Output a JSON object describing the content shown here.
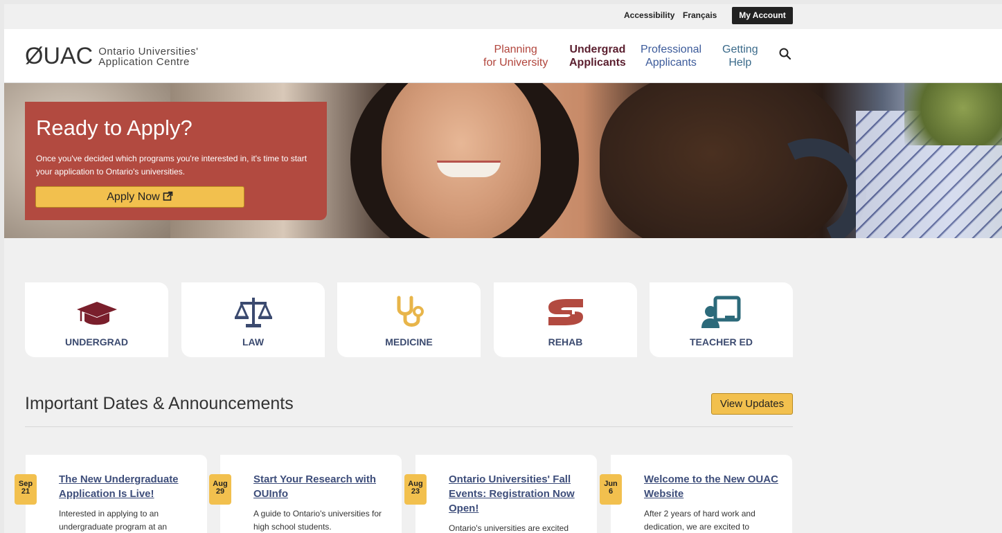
{
  "utility": {
    "accessibility": "Accessibility",
    "french": "Français",
    "account": "My Account"
  },
  "header": {
    "logo_mark": "ØUAC",
    "logo_line1": "Ontario Universities'",
    "logo_line2": "Application Centre",
    "nav": [
      {
        "line1": "Planning",
        "line2": "for University",
        "color": "#b1443b"
      },
      {
        "line1": "Undergrad",
        "line2": "Applicants",
        "color": "#5a1e2e"
      },
      {
        "line1": "Professional",
        "line2": "Applicants",
        "color": "#3b5a9a"
      },
      {
        "line1": "Getting",
        "line2": "Help",
        "color": "#3a6a8a"
      }
    ]
  },
  "hero": {
    "title": "Ready to Apply?",
    "description": "Once you've decided which programs you're interested in, it's time to start your application to Ontario's universities.",
    "button": "Apply Now"
  },
  "categories": [
    {
      "label": "UNDERGRAD",
      "icon": "graduation-cap-icon",
      "color": "#7a1f2c"
    },
    {
      "label": "LAW",
      "icon": "scales-icon",
      "color": "#3b4a6f"
    },
    {
      "label": "MEDICINE",
      "icon": "stethoscope-icon",
      "color": "#e8b54a"
    },
    {
      "label": "REHAB",
      "icon": "helping-hands-icon",
      "color": "#b24a40"
    },
    {
      "label": "TEACHER ED",
      "icon": "teacher-board-icon",
      "color": "#2c6a7a"
    }
  ],
  "announcements": {
    "title": "Important Dates & Announcements",
    "button": "View Updates",
    "items": [
      {
        "month": "Sep",
        "day": "21",
        "title": "The New Undergraduate Application Is Live!",
        "text": "Interested in applying to an undergraduate program at an"
      },
      {
        "month": "Aug",
        "day": "29",
        "title": "Start Your Research with OUInfo",
        "text": "A guide to Ontario's universities for high school students."
      },
      {
        "month": "Aug",
        "day": "23",
        "title": "Ontario Universities' Fall Events: Registration Now Open!",
        "text": "Ontario's universities are excited"
      },
      {
        "month": "Jun",
        "day": "6",
        "title": "Welcome to the New OUAC Website",
        "text": "After 2 years of hard work and dedication, we are excited to"
      }
    ]
  }
}
